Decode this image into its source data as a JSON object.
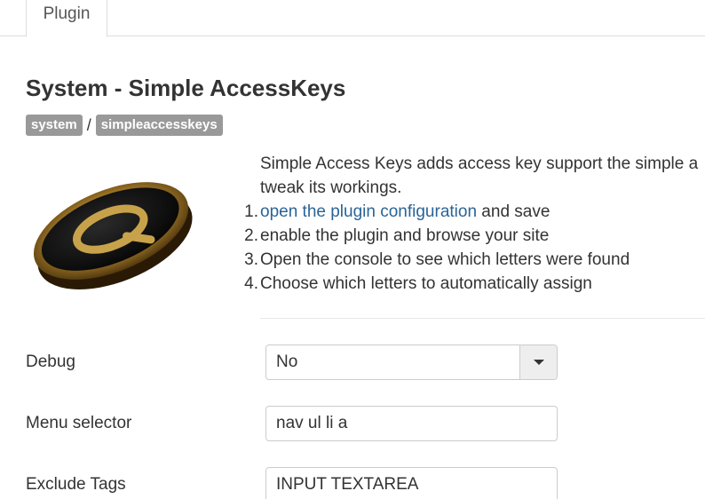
{
  "tabs": [
    {
      "label": "Plugin"
    }
  ],
  "plugin": {
    "title": "System - Simple AccessKeys",
    "breadcrumb": [
      "system",
      "simpleaccesskeys"
    ],
    "breadcrumb_separator": "/"
  },
  "description": {
    "intro_line1": "Simple Access Keys adds access key support the simple a",
    "intro_line2": "tweak its workings.",
    "steps": [
      {
        "num": "1.",
        "link": "open the plugin configuration",
        "text": " and save"
      },
      {
        "num": "2.",
        "text": "enable the plugin and browse your site"
      },
      {
        "num": "3.",
        "text": "Open the console to see which letters were found"
      },
      {
        "num": "4.",
        "text": "Choose which letters to automatically assign"
      }
    ]
  },
  "form": {
    "debug": {
      "label": "Debug",
      "value": "No"
    },
    "menu_selector": {
      "label": "Menu selector",
      "value": "nav ul li a"
    },
    "exclude_tags": {
      "label": "Exclude Tags",
      "value": "INPUT TEXTAREA"
    }
  },
  "colors": {
    "badge": "#999999",
    "link": "#2a6496",
    "logo_gold": "#c8a24a"
  },
  "icons": {
    "logo": "coin-logo-icon",
    "dropdown": "chevron-down-icon"
  }
}
